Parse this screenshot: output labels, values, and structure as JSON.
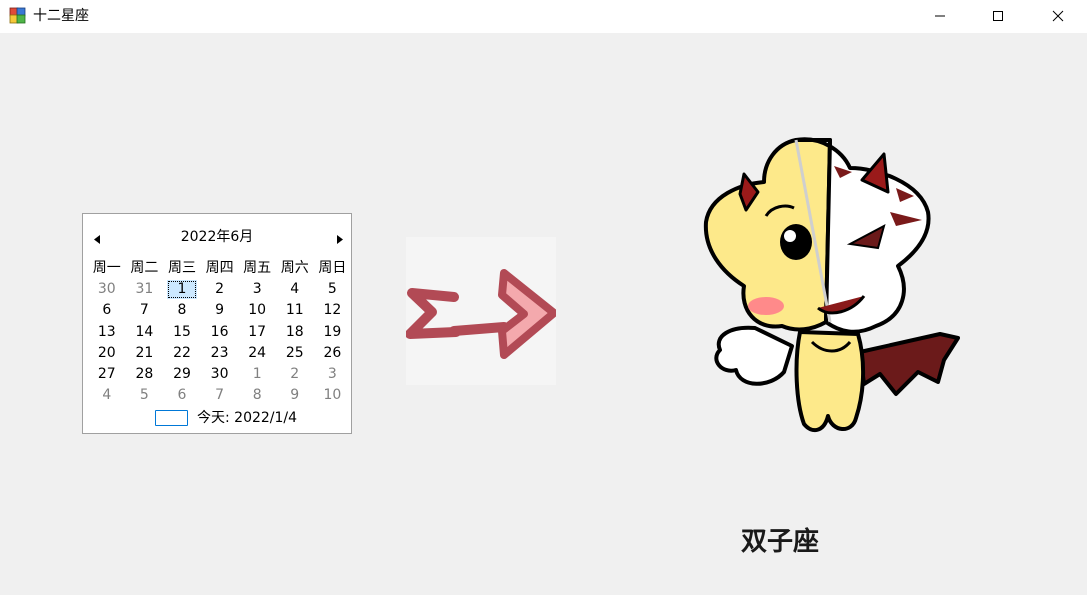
{
  "window": {
    "title": "十二星座",
    "icon": "winforms-app-icon",
    "controls": [
      "minimize-icon",
      "maximize-icon",
      "close-icon"
    ]
  },
  "calendar": {
    "month_label": "2022年6月",
    "weekdays": [
      "周一",
      "周二",
      "周三",
      "周四",
      "周五",
      "周六",
      "周日"
    ],
    "days": [
      {
        "d": "30",
        "other": true
      },
      {
        "d": "31",
        "other": true
      },
      {
        "d": "1",
        "selected": true
      },
      {
        "d": "2"
      },
      {
        "d": "3"
      },
      {
        "d": "4"
      },
      {
        "d": "5"
      },
      {
        "d": "6"
      },
      {
        "d": "7"
      },
      {
        "d": "8"
      },
      {
        "d": "9"
      },
      {
        "d": "10"
      },
      {
        "d": "11"
      },
      {
        "d": "12"
      },
      {
        "d": "13"
      },
      {
        "d": "14"
      },
      {
        "d": "15"
      },
      {
        "d": "16"
      },
      {
        "d": "17"
      },
      {
        "d": "18"
      },
      {
        "d": "19"
      },
      {
        "d": "20"
      },
      {
        "d": "21"
      },
      {
        "d": "22"
      },
      {
        "d": "23"
      },
      {
        "d": "24"
      },
      {
        "d": "25"
      },
      {
        "d": "26"
      },
      {
        "d": "27"
      },
      {
        "d": "28"
      },
      {
        "d": "29"
      },
      {
        "d": "30"
      },
      {
        "d": "1",
        "other": true
      },
      {
        "d": "2",
        "other": true
      },
      {
        "d": "3",
        "other": true
      },
      {
        "d": "4",
        "other": true
      },
      {
        "d": "5",
        "other": true
      },
      {
        "d": "6",
        "other": true
      },
      {
        "d": "7",
        "other": true
      },
      {
        "d": "8",
        "other": true
      },
      {
        "d": "9",
        "other": true
      },
      {
        "d": "10",
        "other": true
      }
    ],
    "today_label": "今天: 2022/1/4"
  },
  "result": {
    "arrow_icon": "arrow-right-image",
    "mascot_icon": "gemini-mascot-image",
    "sign_name": "双子座"
  },
  "colors": {
    "arrow_dark": "#b24a55",
    "arrow_light": "#f4a9ad",
    "today_border": "#0078d7",
    "selected_bg": "#cce8ff"
  }
}
